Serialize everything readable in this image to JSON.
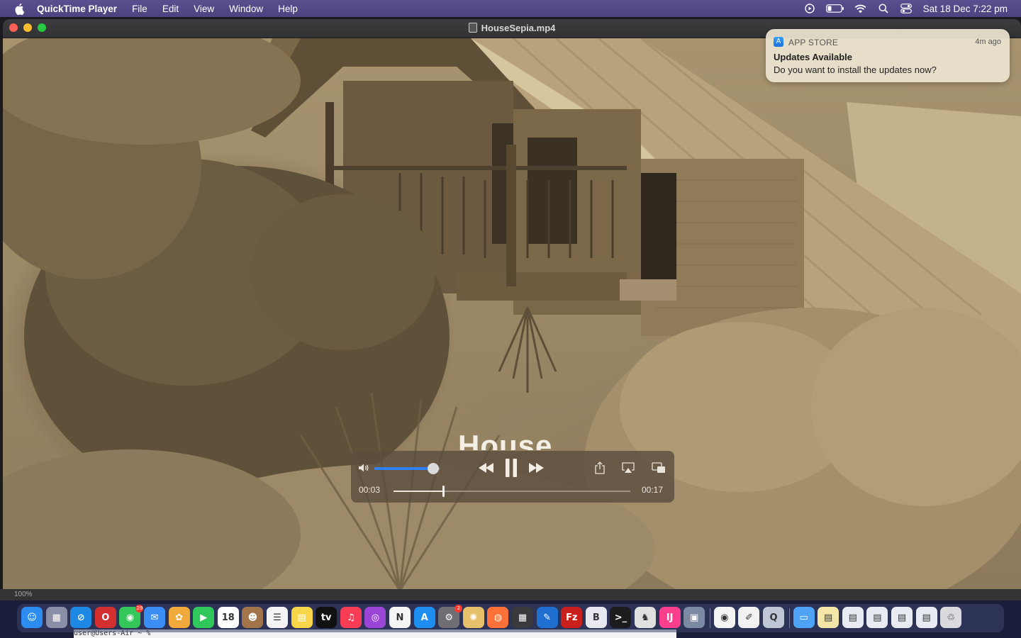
{
  "menubar": {
    "app_name": "QuickTime Player",
    "items": [
      "File",
      "Edit",
      "View",
      "Window",
      "Help"
    ],
    "clock": "Sat 18 Dec  7:22 pm"
  },
  "window": {
    "title": "HouseSepia.mp4"
  },
  "video": {
    "caption_partial": "House",
    "current_time": "00:03",
    "duration": "00:17",
    "volume_fraction": 0.9,
    "progress_fraction": 0.21
  },
  "statusbar": {
    "zoom": "100%"
  },
  "notification": {
    "app_name": "APP STORE",
    "time_ago": "4m ago",
    "title": "Updates Available",
    "body": "Do you want to install the updates now?"
  },
  "terminal": {
    "prompt": "user@Users-Air ~ %"
  },
  "dock": {
    "icons": [
      {
        "name": "finder-icon",
        "color": "#2d8cf0",
        "glyph": "☺"
      },
      {
        "name": "launchpad-icon",
        "color": "#8a8fa8",
        "glyph": "▦"
      },
      {
        "name": "safari-icon",
        "color": "#1e88e5",
        "glyph": "⊘"
      },
      {
        "name": "opera-icon",
        "color": "#d32f2f",
        "glyph": "O"
      },
      {
        "name": "messages-icon",
        "color": "#34c759",
        "glyph": "◉",
        "badge": "29"
      },
      {
        "name": "mail-icon",
        "color": "#3a8ef6",
        "glyph": "✉"
      },
      {
        "name": "photos-icon",
        "color": "#f2a93b",
        "glyph": "✿"
      },
      {
        "name": "facetime-icon",
        "color": "#30c85a",
        "glyph": "▶"
      },
      {
        "name": "calendar-icon",
        "color": "#ffffff",
        "glyph": "18"
      },
      {
        "name": "contacts-icon",
        "color": "#a17449",
        "glyph": "☻"
      },
      {
        "name": "reminders-icon",
        "color": "#f4f4f4",
        "glyph": "☰"
      },
      {
        "name": "notes-icon",
        "color": "#f7d64a",
        "glyph": "▤"
      },
      {
        "name": "appletv-icon",
        "color": "#111111",
        "glyph": "tv"
      },
      {
        "name": "music-icon",
        "color": "#fa3c55",
        "glyph": "♫"
      },
      {
        "name": "podcasts-icon",
        "color": "#9b45d6",
        "glyph": "◎"
      },
      {
        "name": "news-icon",
        "color": "#f5f5f5",
        "glyph": "N"
      },
      {
        "name": "appstore-icon",
        "color": "#1f8ef1",
        "glyph": "A"
      },
      {
        "name": "system-preferences-icon",
        "color": "#6e6e73",
        "glyph": "⚙",
        "badge": "2"
      },
      {
        "name": "pinwheel-icon",
        "color": "#e6c06a",
        "glyph": "✺"
      },
      {
        "name": "firefox-icon",
        "color": "#ff7139",
        "glyph": "◍"
      },
      {
        "name": "calculator-icon",
        "color": "#3a3a3c",
        "glyph": "▦"
      },
      {
        "name": "xcode-icon",
        "color": "#1f6fd1",
        "glyph": "✎"
      },
      {
        "name": "filezilla-icon",
        "color": "#c9201d",
        "glyph": "Fz"
      },
      {
        "name": "bbedit-icon",
        "color": "#e8e8f0",
        "glyph": "B"
      },
      {
        "name": "terminal-icon",
        "color": "#1c1c1e",
        "glyph": ">_"
      },
      {
        "name": "elephant-icon",
        "color": "#e0e0e0",
        "glyph": "♞"
      },
      {
        "name": "intellij-icon",
        "color": "#fc3f8c",
        "glyph": "IJ"
      },
      {
        "name": "preview-icon",
        "color": "#7c8aa3",
        "glyph": "▣"
      },
      {
        "name": "chrome-icon",
        "color": "#f4f4f4",
        "glyph": "◉"
      },
      {
        "name": "textedit-icon",
        "color": "#f2f2f2",
        "glyph": "✐"
      },
      {
        "name": "quicktime-icon",
        "color": "#bfc7d6",
        "glyph": "Q"
      },
      {
        "name": "downloads-folder-icon",
        "color": "#4fa3f7",
        "glyph": "▭"
      },
      {
        "name": "document-stack-icon",
        "color": "#f3e6a8",
        "glyph": "▤"
      },
      {
        "name": "document-stack-2-icon",
        "color": "#e8ecf2",
        "glyph": "▤"
      },
      {
        "name": "document-stack-3-icon",
        "color": "#e8ecf2",
        "glyph": "▤"
      },
      {
        "name": "document-stack-4-icon",
        "color": "#e8ecf2",
        "glyph": "▤"
      },
      {
        "name": "document-stack-5-icon",
        "color": "#e8ecf2",
        "glyph": "▤"
      },
      {
        "name": "trash-icon",
        "color": "#d9d9de",
        "glyph": "♲"
      }
    ]
  }
}
